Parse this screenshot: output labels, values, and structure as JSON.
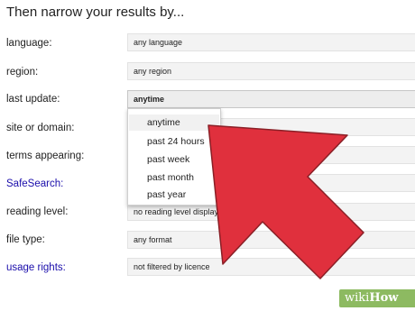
{
  "heading": "Then narrow your results by...",
  "rows": [
    {
      "label": "language:",
      "value": "any language",
      "link": false
    },
    {
      "label": "region:",
      "value": "any region",
      "link": false
    },
    {
      "label": "last update:",
      "value": "anytime",
      "link": false
    },
    {
      "label": "site or domain:",
      "value": "",
      "link": false
    },
    {
      "label": "terms appearing:",
      "value": "",
      "link": false
    },
    {
      "label": "SafeSearch:",
      "value": "",
      "link": true
    },
    {
      "label": "reading level:",
      "value": "no reading level displayed",
      "link": false
    },
    {
      "label": "file type:",
      "value": "any format",
      "link": false
    },
    {
      "label": "usage rights:",
      "value": "not filtered by licence",
      "link": true
    }
  ],
  "dropdown": {
    "options": [
      "anytime",
      "past 24 hours",
      "past week",
      "past month",
      "past year"
    ],
    "highlighted": "anytime"
  },
  "arrow": {
    "color": "#e0303d",
    "outline": "#8a1f26"
  },
  "watermark": {
    "wiki": "wiki",
    "how": "How"
  }
}
